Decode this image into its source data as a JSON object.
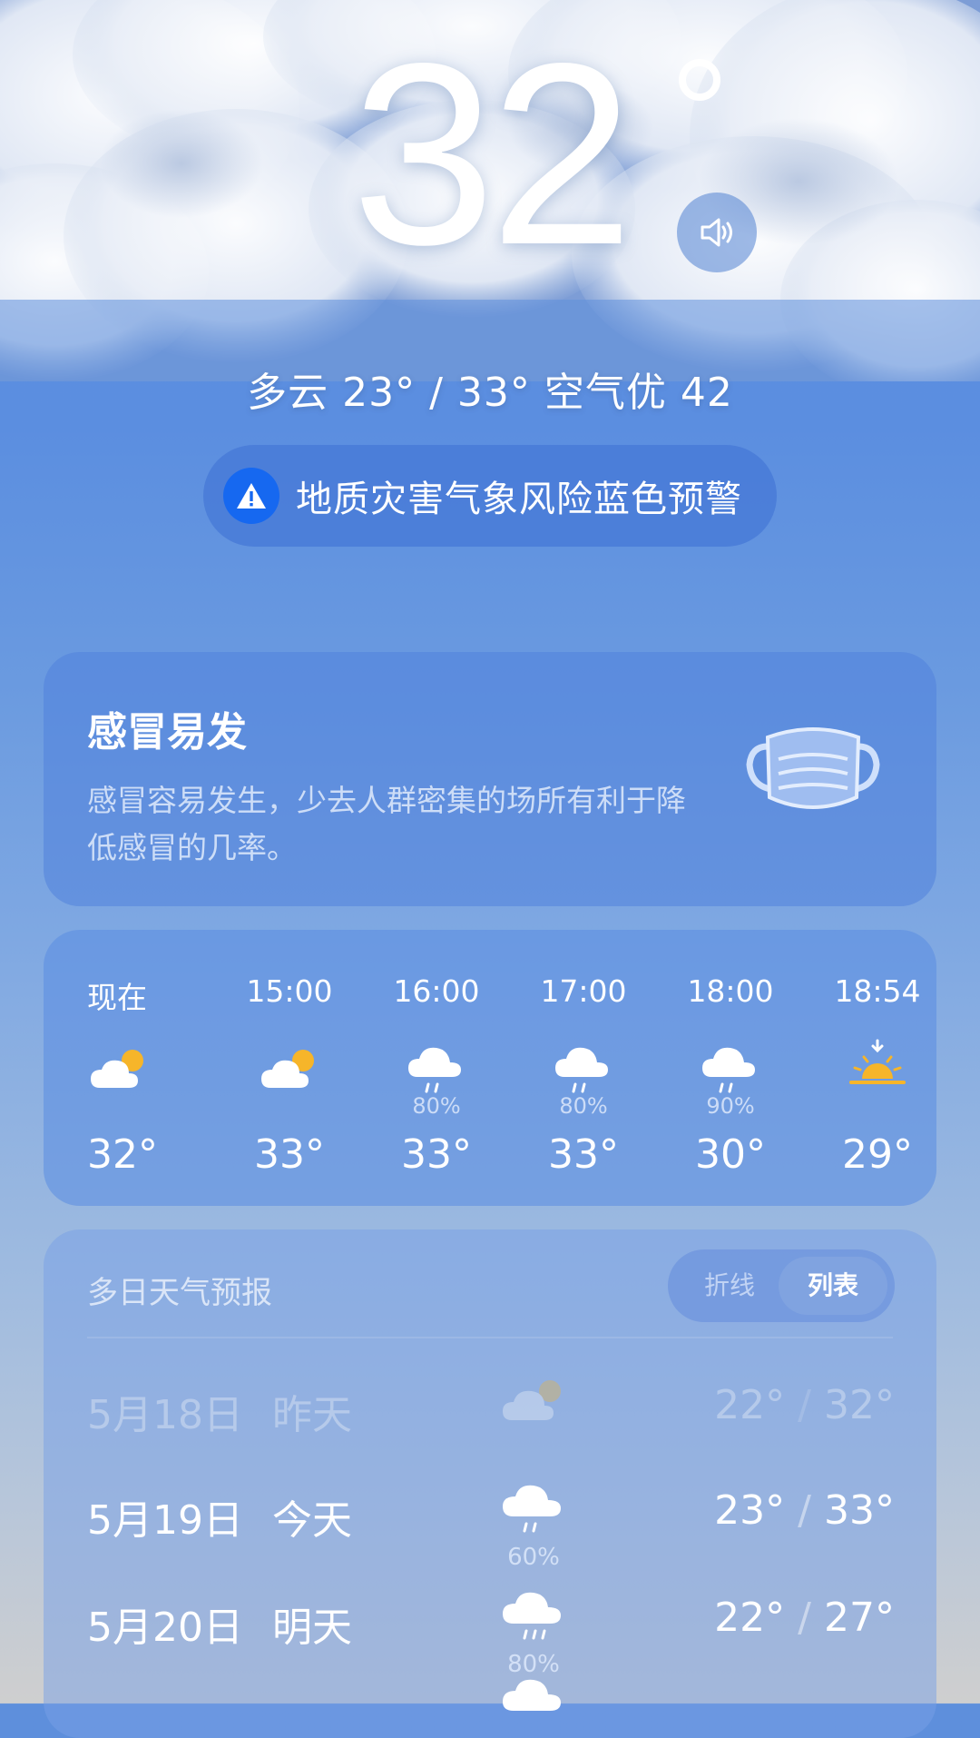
{
  "current": {
    "temperature": "32",
    "summary": "多云  23° / 33°  空气优 42",
    "alert": "地质灾害气象风险蓝色预警"
  },
  "tip": {
    "title": "感冒易发",
    "description": "感冒容易发生，少去人群密集的场所有利于降低感冒的几率。"
  },
  "hourly": [
    {
      "time": "现在",
      "icon": "cloudy-sun-icon",
      "pct": "",
      "temp": "32°"
    },
    {
      "time": "15:00",
      "icon": "cloudy-sun-icon",
      "pct": "",
      "temp": "33°"
    },
    {
      "time": "16:00",
      "icon": "rain-icon",
      "pct": "80%",
      "temp": "33°"
    },
    {
      "time": "17:00",
      "icon": "rain-icon",
      "pct": "80%",
      "temp": "33°"
    },
    {
      "time": "18:00",
      "icon": "rain-icon",
      "pct": "90%",
      "temp": "30°"
    },
    {
      "time": "18:54",
      "icon": "sunset-icon",
      "pct": "",
      "temp": "29°"
    }
  ],
  "daily": {
    "title": "多日天气预报",
    "toggle_line": "折线",
    "toggle_list": "列表",
    "rows": [
      {
        "date": "5月18日",
        "day": "昨天",
        "icon": "cloudy-sun-icon",
        "pct": "",
        "low": "22°",
        "high": "32°"
      },
      {
        "date": "5月19日",
        "day": "今天",
        "icon": "rain-icon",
        "pct": "60%",
        "low": "23°",
        "high": "33°"
      },
      {
        "date": "5月20日",
        "day": "明天",
        "icon": "rain-icon",
        "pct": "80%",
        "low": "22°",
        "high": "27°"
      }
    ]
  },
  "colors": {
    "accent": "#1668f0",
    "sun": "#f6b52a"
  }
}
